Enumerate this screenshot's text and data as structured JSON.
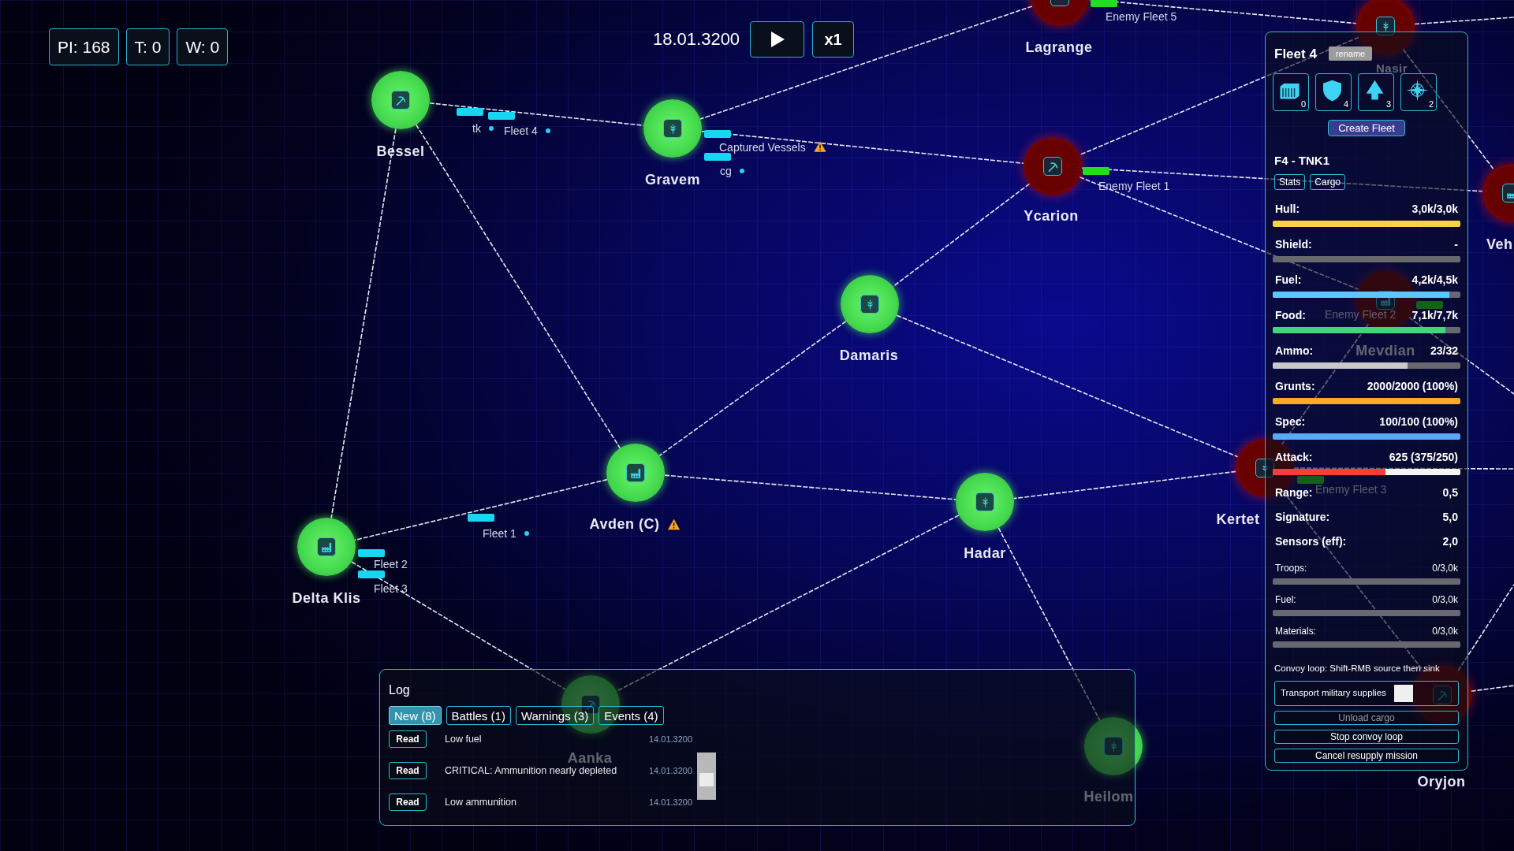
{
  "hud": {
    "counters": [
      "PI: 168",
      "T: 0",
      "W: 0"
    ],
    "date": "18.01.3200",
    "speed": "x1"
  },
  "map": {
    "systems": [
      {
        "name": "Lagrange",
        "kind": "unknown",
        "hostile": true,
        "warning": false
      },
      {
        "name": "Nasir",
        "kind": "farm",
        "hostile": true,
        "warning": false
      },
      {
        "name": "Bessel",
        "kind": "mine",
        "hostile": false,
        "warning": false
      },
      {
        "name": "Gravem",
        "kind": "farm",
        "hostile": false,
        "warning": false
      },
      {
        "name": "Ycarion",
        "kind": "mine",
        "hostile": true,
        "warning": false
      },
      {
        "name": "Veh",
        "kind": "factory",
        "hostile": true,
        "warning": false
      },
      {
        "name": "Damaris",
        "kind": "farm",
        "hostile": false,
        "warning": false
      },
      {
        "name": "Mevdian",
        "kind": "factory",
        "hostile": true,
        "warning": false
      },
      {
        "name": "Kertet",
        "kind": "farm",
        "hostile": true,
        "warning": false
      },
      {
        "name": "Avden (C)",
        "kind": "factory",
        "hostile": false,
        "warning": true
      },
      {
        "name": "Hadar",
        "kind": "farm",
        "hostile": false,
        "warning": false
      },
      {
        "name": "Delta Klis",
        "kind": "factory",
        "hostile": false,
        "warning": false
      },
      {
        "name": "Oryjon",
        "kind": "mine",
        "hostile": true,
        "warning": false
      },
      {
        "name": "Aanka",
        "kind": "mine",
        "hostile": false,
        "warning": false
      },
      {
        "name": "Heilom",
        "kind": "farm",
        "hostile": false,
        "warning": false
      }
    ]
  },
  "fleets": [
    {
      "label": "Enemy Fleet 5",
      "kind": "enemy",
      "dot": false,
      "warning": false
    },
    {
      "label": "tk",
      "kind": "friendly",
      "dot": true,
      "warning": false
    },
    {
      "label": "Fleet 4",
      "kind": "friendly",
      "dot": true,
      "warning": false
    },
    {
      "label": "Captured Vessels",
      "kind": "friendly",
      "dot": false,
      "warning": true
    },
    {
      "label": "cg",
      "kind": "friendly",
      "dot": true,
      "warning": false
    },
    {
      "label": "Enemy Fleet 1",
      "kind": "enemy",
      "dot": false,
      "warning": false
    },
    {
      "label": "Enemy Fleet 2",
      "kind": "enemy",
      "dot": false,
      "warning": false
    },
    {
      "label": "Enemy Fleet 3",
      "kind": "enemy",
      "dot": false,
      "warning": false
    },
    {
      "label": "Fleet 1",
      "kind": "friendly",
      "dot": true,
      "warning": false
    },
    {
      "label": "Fleet 2",
      "kind": "friendly",
      "dot": false,
      "warning": false
    },
    {
      "label": "Fleet 3",
      "kind": "friendly",
      "dot": false,
      "warning": false
    }
  ],
  "fleet_panel": {
    "title": "Fleet 4",
    "rename": "rename",
    "ship_types": [
      {
        "kind": "cargo",
        "count": "0"
      },
      {
        "kind": "defense",
        "count": "4"
      },
      {
        "kind": "strike",
        "count": "3"
      },
      {
        "kind": "recon",
        "count": "2"
      }
    ],
    "create": "Create Fleet",
    "ship": "F4 - TNK1",
    "tabs": [
      "Stats",
      "Cargo"
    ],
    "stats": [
      {
        "kind": "bar",
        "label": "Hull:",
        "value": "3,0k/3,0k",
        "level": 1,
        "color": "#f9d142"
      },
      {
        "kind": "bar",
        "label": "Shield:",
        "value": "-",
        "level": 0
      },
      {
        "kind": "bar",
        "label": "Fuel:",
        "value": "4,2k/4,5k",
        "level": 0.94,
        "color": "#5ac8fa"
      },
      {
        "kind": "bar",
        "label": "Food:",
        "value": "7,1k/7,7k",
        "level": 0.92,
        "color": "#3fd77a"
      },
      {
        "kind": "bar",
        "label": "Ammo:",
        "value": "23/32",
        "level": 0.72,
        "color": "#c9c9c9"
      },
      {
        "kind": "bar",
        "label": "Grunts:",
        "value": "2000/2000 (100%)",
        "level": 1,
        "color": "#ffa826"
      },
      {
        "kind": "bar",
        "label": "Spec:",
        "value": "100/100 (100%)",
        "level": 1,
        "color": "#5aa9f8"
      },
      {
        "kind": "split",
        "label": "Attack:",
        "value": "625 (375/250)",
        "level": 0.6,
        "color": "#fa3c3c"
      },
      {
        "kind": "plain",
        "label": "Range:",
        "value": "0,5"
      },
      {
        "kind": "plain",
        "label": "Signature:",
        "value": "5,0"
      },
      {
        "kind": "plain",
        "label": "Sensors (eff):",
        "value": "2,0"
      }
    ],
    "cargo": [
      {
        "label": "Troops:",
        "value": "0/3,0k",
        "level": 0
      },
      {
        "label": "Fuel:",
        "value": "0/3,0k",
        "level": 0
      },
      {
        "label": "Materials:",
        "value": "0/3,0k",
        "level": 0
      }
    ],
    "convoy": {
      "hint": "Convoy loop: Shift-RMB source then sink",
      "transport": {
        "label": "Transport military supplies",
        "checked": false
      },
      "actions": [
        {
          "label": "Unload cargo",
          "disabled": true
        },
        {
          "label": "Stop convoy loop",
          "disabled": false
        },
        {
          "label": "Cancel resupply mission",
          "disabled": false
        }
      ]
    }
  },
  "log": {
    "title": "Log",
    "tabs": [
      {
        "label": "New (8)",
        "selected": true
      },
      {
        "label": "Battles (1)",
        "selected": false
      },
      {
        "label": "Warnings (3)",
        "selected": false
      },
      {
        "label": "Events (4)",
        "selected": false
      }
    ],
    "entries": [
      {
        "action": "Read",
        "text": "Low fuel",
        "date": "14.01.3200"
      },
      {
        "action": "Read",
        "text": "CRITICAL: Ammunition nearly depleted",
        "date": "14.01.3200"
      },
      {
        "action": "Read",
        "text": "Low ammunition",
        "date": "14.01.3200"
      }
    ]
  }
}
